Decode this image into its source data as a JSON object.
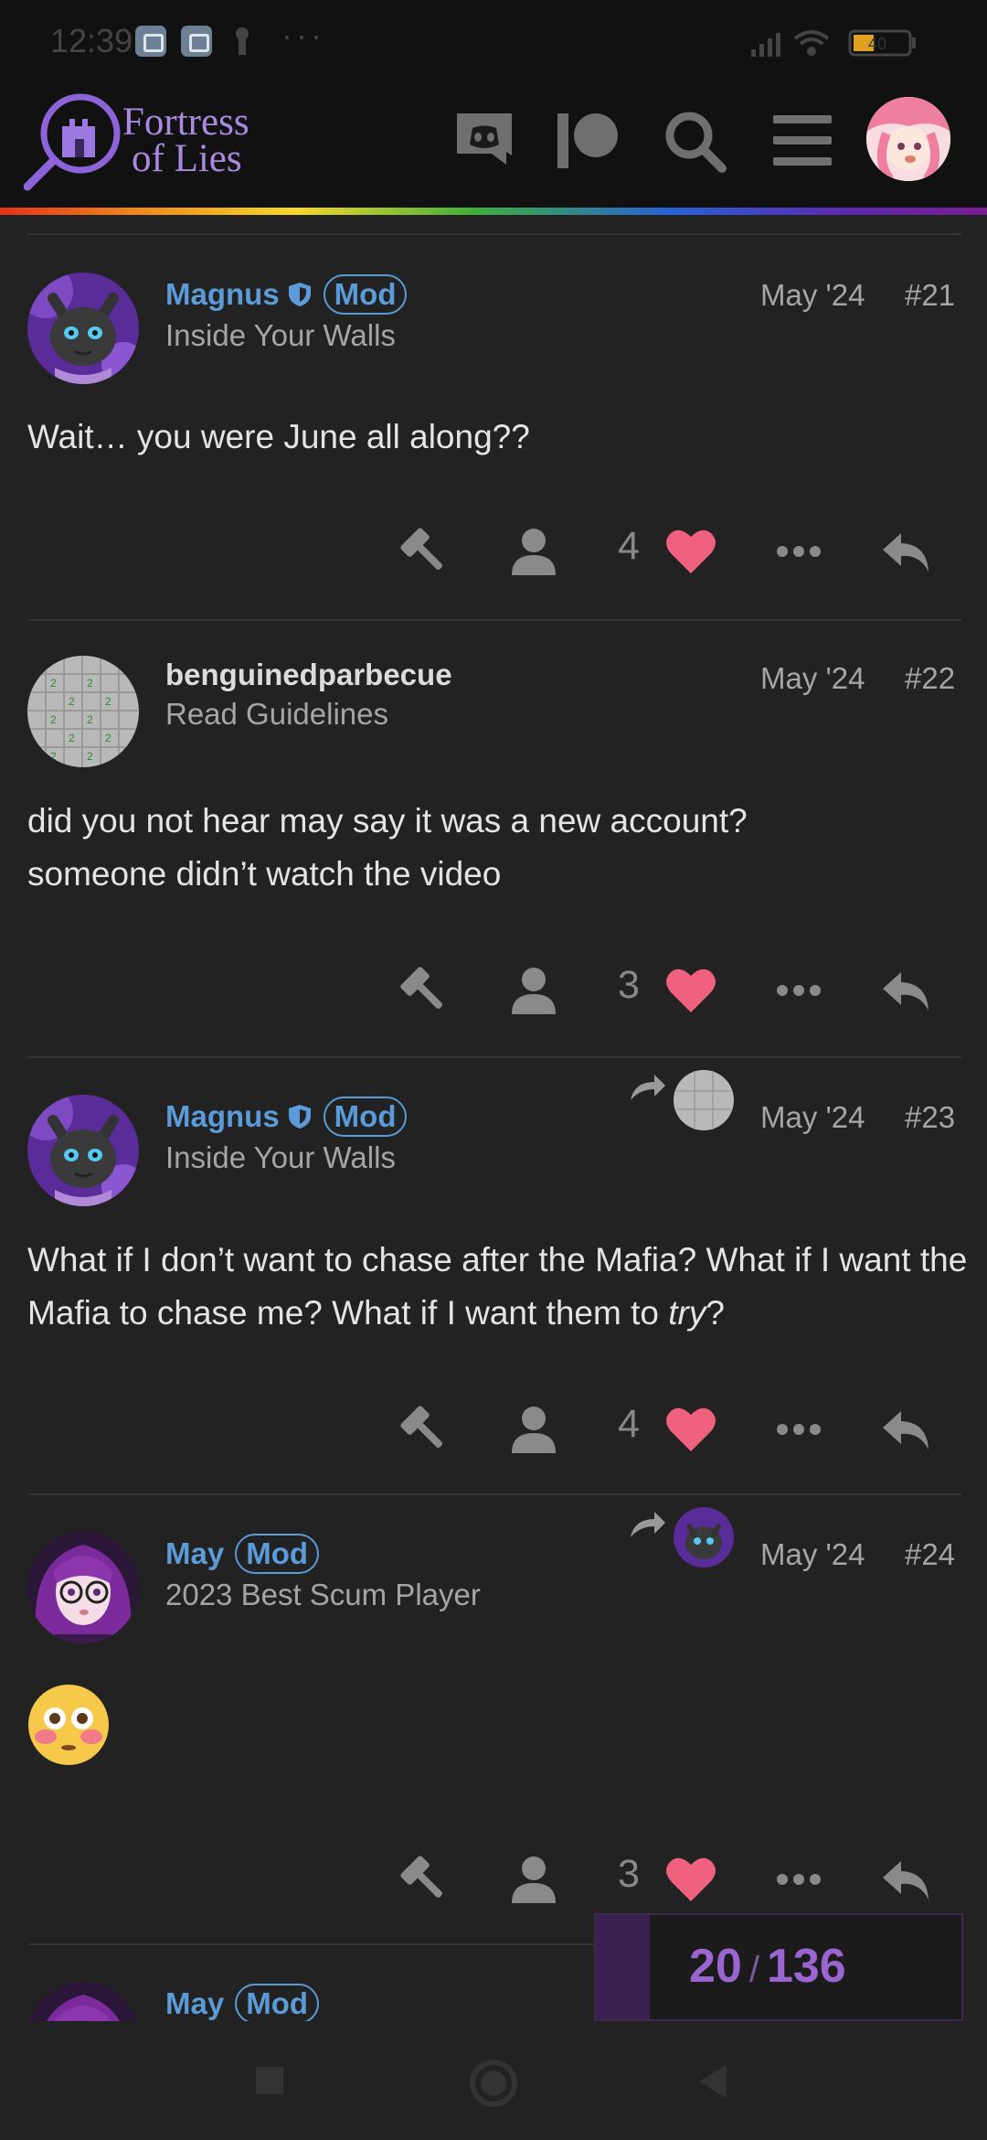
{
  "status_bar": {
    "time": "12:39",
    "battery": "40"
  },
  "header": {
    "logo_line1": "Fortress",
    "logo_line2": "of Lies"
  },
  "posts": [
    {
      "username": "Magnus",
      "badge": "Mod",
      "user_title": "Inside Your Walls",
      "date": "May '24",
      "post_number": "#21",
      "body": "Wait… you were June all along??",
      "likes": "4"
    },
    {
      "username": "benguinedparbecue",
      "user_title": "Read Guidelines",
      "date": "May '24",
      "post_number": "#22",
      "body_line1": "did you not hear may say it was a new account?",
      "body_line2": "someone didn’t watch the video",
      "likes": "3"
    },
    {
      "username": "Magnus",
      "badge": "Mod",
      "user_title": "Inside Your Walls",
      "date": "May '24",
      "post_number": "#23",
      "body_a": "What if I don’t want to chase after the Mafia? What if I want the Mafia to chase me? What if I want them to ",
      "body_em": "try",
      "body_b": "?",
      "likes": "4"
    },
    {
      "username": "May",
      "badge": "Mod",
      "user_title": "2023 Best Scum Player",
      "date": "May '24",
      "post_number": "#24",
      "emoji": "flushed-face",
      "likes": "3"
    },
    {
      "username": "May",
      "badge": "Mod"
    }
  ],
  "progress": {
    "current": "20",
    "total": "136",
    "fraction": 0.147
  },
  "colors": {
    "accent": "#5a9bd8",
    "like": "#f0607f",
    "progress": "#9a65d0",
    "logo": "#a98ae0"
  }
}
